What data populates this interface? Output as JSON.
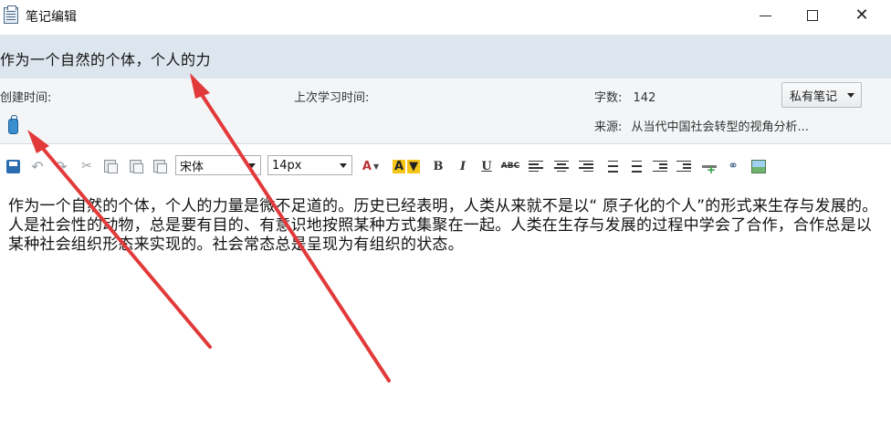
{
  "window": {
    "title": "笔记编辑",
    "controls": {
      "minimize": "minimize",
      "maximize": "maximize",
      "close": "close"
    }
  },
  "note": {
    "title": "作为一个自然的个体，个人的力"
  },
  "meta": {
    "created_label": "创建时间:",
    "last_study_label": "上次学习时间:",
    "word_count_label": "字数:",
    "word_count_value": "142",
    "source_label": "来源:",
    "source_value": "从当代中国社会转型的视角分析...",
    "visibility_button": "私有笔记"
  },
  "toolbar": {
    "font_family": "宋体",
    "font_size": "14px",
    "font_color_glyph": "A",
    "bg_color_glyph": "A",
    "bold": "B",
    "italic": "I",
    "underline": "U",
    "strikethrough": "ABC",
    "icons": [
      "save-icon",
      "undo-icon",
      "redo-icon",
      "cut-icon",
      "copy-icon",
      "paste-icon",
      "paste-text-icon",
      "align-left-icon",
      "align-center-icon",
      "align-right-icon",
      "ordered-list-icon",
      "unordered-list-icon",
      "outdent-icon",
      "indent-icon",
      "horizontal-rule-icon",
      "link-icon",
      "insert-image-icon"
    ]
  },
  "editor": {
    "content": "作为一个自然的个体，个人的力量是微不足道的。历史已经表明，人类从来就不是以“ 原子化的个人”的形式来生存与发展的。人是社会性的动物，总是要有目的、有意识地按照某种方式集聚在一起。人类在生存与发展的过程中学会了合作，合作总是以某种社会组织形态来实现的。社会常态总是呈现为有组织的状态。"
  },
  "colors": {
    "header_band": "#dde6ee",
    "meta_band": "#f3f5f7",
    "arrow": "#e23a3a"
  }
}
